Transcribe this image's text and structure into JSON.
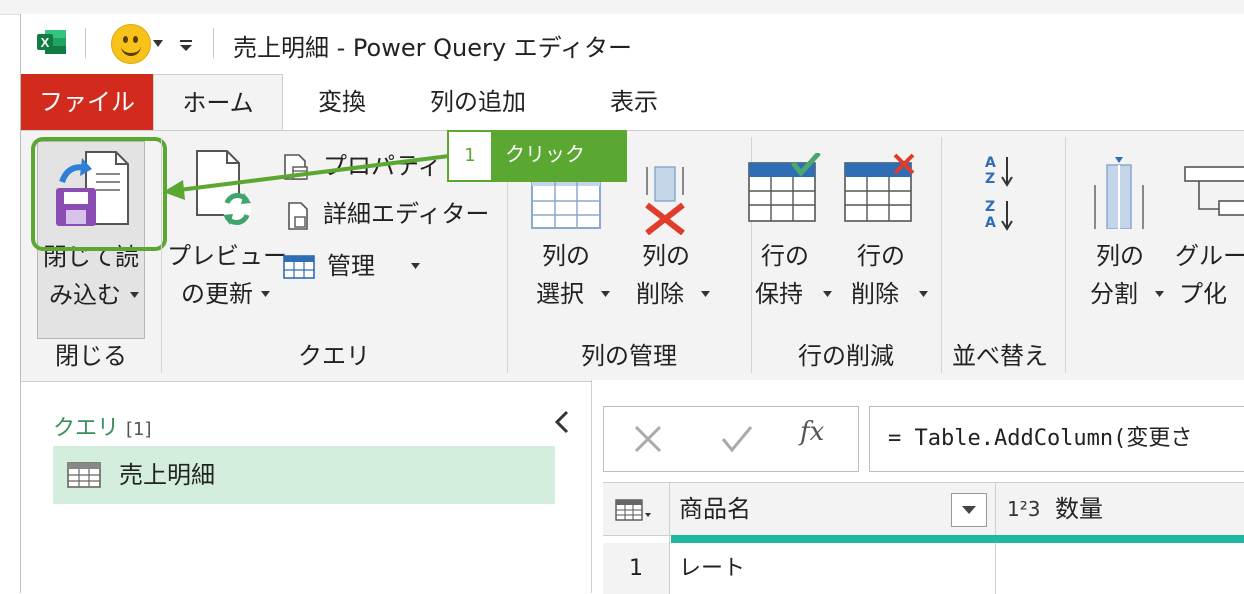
{
  "window": {
    "title": "売上明細 - Power Query エディター"
  },
  "tabs": [
    {
      "label": "ファイル"
    },
    {
      "label": "ホーム"
    },
    {
      "label": "変換"
    },
    {
      "label": "列の追加"
    },
    {
      "label": "表示"
    }
  ],
  "ribbon": {
    "close_group": {
      "label": "閉じる",
      "close_load": {
        "line1": "閉じて読",
        "line2": "み込む"
      }
    },
    "query_group": {
      "label": "クエリ",
      "preview": {
        "line1": "プレビュー",
        "line2": "の更新"
      },
      "properties": "プロパティ",
      "advanced_editor": "詳細エディター",
      "manage": "管理"
    },
    "manage_columns_group": {
      "label": "列の管理",
      "choose_columns": {
        "line1": "列の",
        "line2": "選択"
      },
      "remove_columns": {
        "line1": "列の",
        "line2": "削除"
      }
    },
    "reduce_rows_group": {
      "label": "行の削減",
      "keep_rows": {
        "line1": "行の",
        "line2": "保持"
      },
      "remove_rows": {
        "line1": "行の",
        "line2": "削除"
      }
    },
    "sort_group": {
      "label": "並べ替え"
    },
    "transform_group": {
      "split_column": {
        "line1": "列の",
        "line2": "分割"
      },
      "group_by": {
        "line1": "グルー",
        "line2": "プ化"
      }
    }
  },
  "callout": {
    "number": "1",
    "text": "クリック"
  },
  "query_pane": {
    "title": "クエリ",
    "count": "[1]",
    "items": [
      {
        "label": "売上明細"
      }
    ]
  },
  "formula": {
    "fx": "fx",
    "text": "= Table.AddColumn(変更さ"
  },
  "grid": {
    "columns": [
      {
        "label": "商品名",
        "type_icon": "text"
      },
      {
        "label": "数量",
        "type_icon": "1²3"
      }
    ],
    "rows": [
      {
        "num": "1",
        "values": [
          "レート",
          ""
        ]
      }
    ]
  },
  "colors": {
    "file_tab": "#d22a1c",
    "highlight_green": "#5aa832",
    "query_item_bg": "#d4eedd",
    "teal_line": "#1fb8a3"
  }
}
